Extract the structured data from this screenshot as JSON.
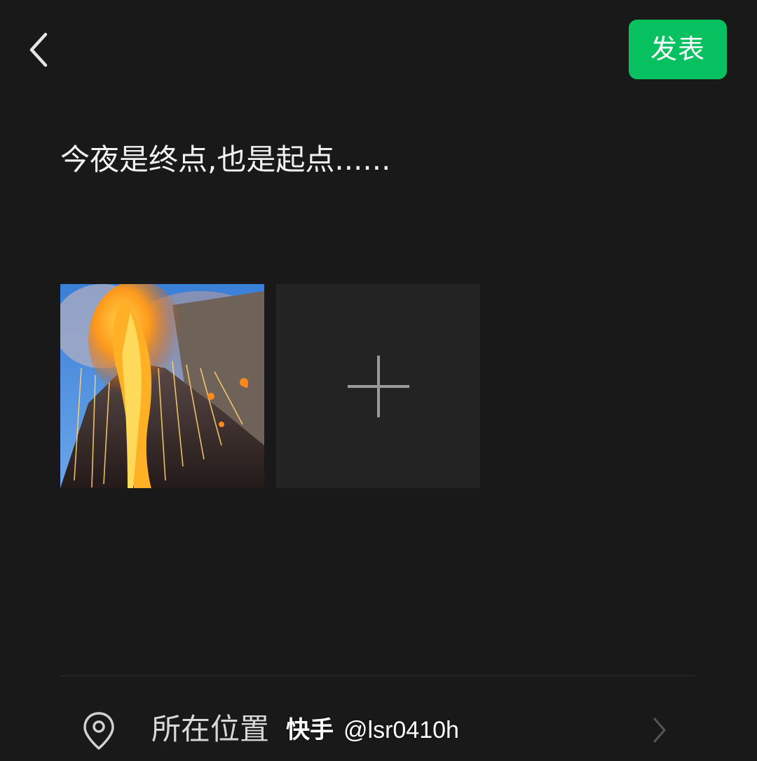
{
  "header": {
    "back_icon": "chevron-left-icon",
    "publish_label": "发表"
  },
  "post": {
    "text": "今夜是终点,也是起点......"
  },
  "media": {
    "items": [
      {
        "icon": "volcano-photo"
      }
    ],
    "add_icon": "plus-icon"
  },
  "location": {
    "icon": "location-pin-icon",
    "label": "所在位置",
    "chevron_icon": "chevron-right-icon"
  },
  "watermark": {
    "brand": "快手",
    "handle": "@lsr0410h"
  },
  "colors": {
    "background": "#191919",
    "accent": "#07c160",
    "tile": "#232323"
  }
}
